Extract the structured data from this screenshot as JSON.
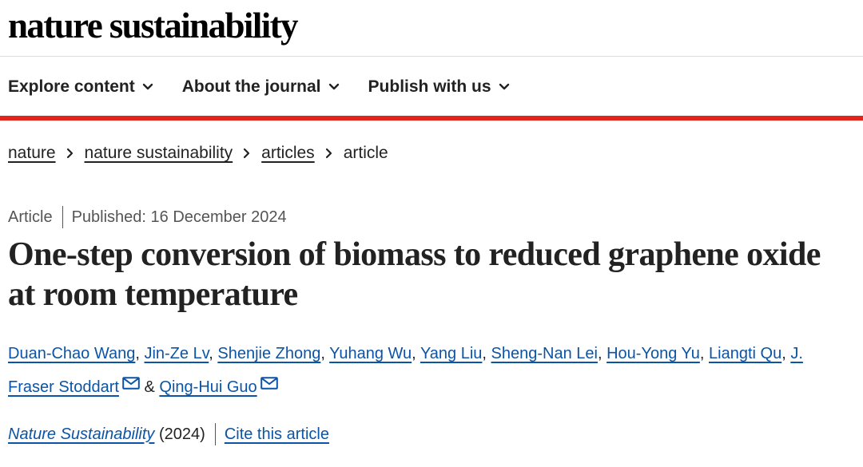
{
  "brand": {
    "name": "nature sustainability"
  },
  "nav": {
    "items": [
      {
        "label": "Explore content",
        "icon": "chevron-down-icon"
      },
      {
        "label": "About the journal",
        "icon": "chevron-down-icon"
      },
      {
        "label": "Publish with us",
        "icon": "chevron-down-icon"
      }
    ]
  },
  "colors": {
    "accent": "#e1251b",
    "link": "#0b54a6",
    "text": "#222222",
    "muted": "#555555"
  },
  "breadcrumb": {
    "items": [
      "nature",
      "nature sustainability",
      "articles"
    ],
    "current": "article"
  },
  "article": {
    "type": "Article",
    "published": "Published: 16 December 2024",
    "title": "One-step conversion of biomass to reduced graphene oxide at room temperature",
    "authors": [
      "Duan-Chao Wang",
      "Jin-Ze Lv",
      "Shenjie Zhong",
      "Yuhang Wu",
      "Yang Liu",
      "Sheng-Nan Lei",
      "Hou-Yong Yu",
      "Liangti Qu",
      "J. Fraser Stoddart",
      "Qing-Hui Guo"
    ],
    "author_separator": ", ",
    "author_conjunction": " & ",
    "journal": "Nature Sustainability",
    "year": "(2024)",
    "cite_label": "Cite this article"
  }
}
